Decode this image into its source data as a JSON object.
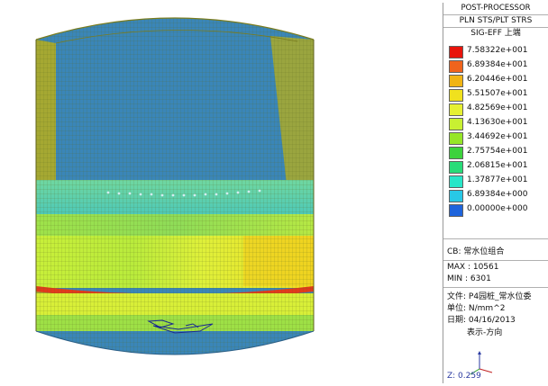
{
  "panel": {
    "title": "POST-PROCESSOR",
    "subtitle": "PLN STS/PLT STRS",
    "component": "SIG-EFF 上端"
  },
  "legend": [
    {
      "value": "7.58322e+001",
      "color": "#e8140c"
    },
    {
      "value": "6.89384e+001",
      "color": "#f0641c"
    },
    {
      "value": "6.20446e+001",
      "color": "#f0b414"
    },
    {
      "value": "5.51507e+001",
      "color": "#f0e11e"
    },
    {
      "value": "4.82569e+001",
      "color": "#e6f032"
    },
    {
      "value": "4.13630e+001",
      "color": "#c8f032"
    },
    {
      "value": "3.44692e+001",
      "color": "#96e628"
    },
    {
      "value": "2.75754e+001",
      "color": "#3cd23c"
    },
    {
      "value": "2.06815e+001",
      "color": "#28dc78"
    },
    {
      "value": "1.37877e+001",
      "color": "#28e6c8"
    },
    {
      "value": "6.89384e+000",
      "color": "#28c8e6"
    },
    {
      "value": "0.00000e+000",
      "color": "#1e64dc"
    }
  ],
  "info": {
    "cb": "CB: 常水位组合",
    "max": "MAX : 10561",
    "min": "MIN : 6301",
    "file": "文件: P4园桩_常水位委",
    "unit": "单位: N/mm^2",
    "date": "日期: 04/16/2013",
    "view": "表示-方向",
    "coord_z": "Z: 0.259"
  },
  "colors": {
    "mesh_blue": "#3a86b8",
    "mesh_olive": "#a5a832",
    "mesh_line": "#6b6e1a"
  }
}
